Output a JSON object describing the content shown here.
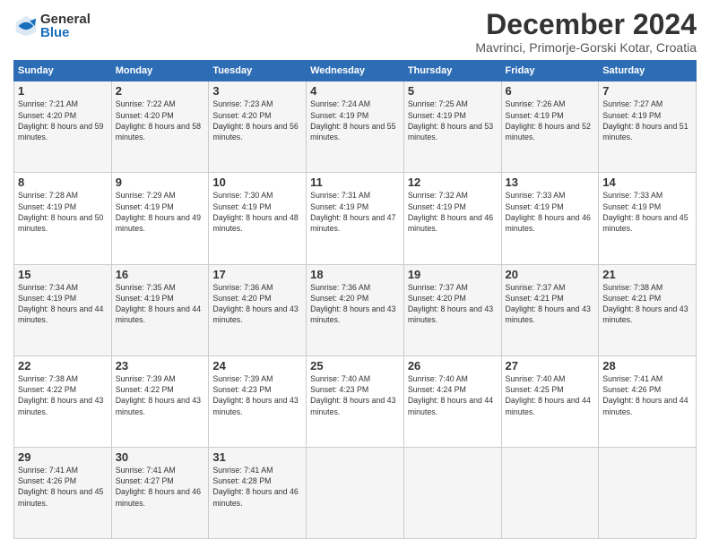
{
  "logo": {
    "general": "General",
    "blue": "Blue"
  },
  "title": {
    "main": "December 2024",
    "sub": "Mavrinci, Primorje-Gorski Kotar, Croatia"
  },
  "headers": [
    "Sunday",
    "Monday",
    "Tuesday",
    "Wednesday",
    "Thursday",
    "Friday",
    "Saturday"
  ],
  "weeks": [
    [
      {
        "day": "1",
        "sunrise": "Sunrise: 7:21 AM",
        "sunset": "Sunset: 4:20 PM",
        "daylight": "Daylight: 8 hours and 59 minutes."
      },
      {
        "day": "2",
        "sunrise": "Sunrise: 7:22 AM",
        "sunset": "Sunset: 4:20 PM",
        "daylight": "Daylight: 8 hours and 58 minutes."
      },
      {
        "day": "3",
        "sunrise": "Sunrise: 7:23 AM",
        "sunset": "Sunset: 4:20 PM",
        "daylight": "Daylight: 8 hours and 56 minutes."
      },
      {
        "day": "4",
        "sunrise": "Sunrise: 7:24 AM",
        "sunset": "Sunset: 4:19 PM",
        "daylight": "Daylight: 8 hours and 55 minutes."
      },
      {
        "day": "5",
        "sunrise": "Sunrise: 7:25 AM",
        "sunset": "Sunset: 4:19 PM",
        "daylight": "Daylight: 8 hours and 53 minutes."
      },
      {
        "day": "6",
        "sunrise": "Sunrise: 7:26 AM",
        "sunset": "Sunset: 4:19 PM",
        "daylight": "Daylight: 8 hours and 52 minutes."
      },
      {
        "day": "7",
        "sunrise": "Sunrise: 7:27 AM",
        "sunset": "Sunset: 4:19 PM",
        "daylight": "Daylight: 8 hours and 51 minutes."
      }
    ],
    [
      {
        "day": "8",
        "sunrise": "Sunrise: 7:28 AM",
        "sunset": "Sunset: 4:19 PM",
        "daylight": "Daylight: 8 hours and 50 minutes."
      },
      {
        "day": "9",
        "sunrise": "Sunrise: 7:29 AM",
        "sunset": "Sunset: 4:19 PM",
        "daylight": "Daylight: 8 hours and 49 minutes."
      },
      {
        "day": "10",
        "sunrise": "Sunrise: 7:30 AM",
        "sunset": "Sunset: 4:19 PM",
        "daylight": "Daylight: 8 hours and 48 minutes."
      },
      {
        "day": "11",
        "sunrise": "Sunrise: 7:31 AM",
        "sunset": "Sunset: 4:19 PM",
        "daylight": "Daylight: 8 hours and 47 minutes."
      },
      {
        "day": "12",
        "sunrise": "Sunrise: 7:32 AM",
        "sunset": "Sunset: 4:19 PM",
        "daylight": "Daylight: 8 hours and 46 minutes."
      },
      {
        "day": "13",
        "sunrise": "Sunrise: 7:33 AM",
        "sunset": "Sunset: 4:19 PM",
        "daylight": "Daylight: 8 hours and 46 minutes."
      },
      {
        "day": "14",
        "sunrise": "Sunrise: 7:33 AM",
        "sunset": "Sunset: 4:19 PM",
        "daylight": "Daylight: 8 hours and 45 minutes."
      }
    ],
    [
      {
        "day": "15",
        "sunrise": "Sunrise: 7:34 AM",
        "sunset": "Sunset: 4:19 PM",
        "daylight": "Daylight: 8 hours and 44 minutes."
      },
      {
        "day": "16",
        "sunrise": "Sunrise: 7:35 AM",
        "sunset": "Sunset: 4:19 PM",
        "daylight": "Daylight: 8 hours and 44 minutes."
      },
      {
        "day": "17",
        "sunrise": "Sunrise: 7:36 AM",
        "sunset": "Sunset: 4:20 PM",
        "daylight": "Daylight: 8 hours and 43 minutes."
      },
      {
        "day": "18",
        "sunrise": "Sunrise: 7:36 AM",
        "sunset": "Sunset: 4:20 PM",
        "daylight": "Daylight: 8 hours and 43 minutes."
      },
      {
        "day": "19",
        "sunrise": "Sunrise: 7:37 AM",
        "sunset": "Sunset: 4:20 PM",
        "daylight": "Daylight: 8 hours and 43 minutes."
      },
      {
        "day": "20",
        "sunrise": "Sunrise: 7:37 AM",
        "sunset": "Sunset: 4:21 PM",
        "daylight": "Daylight: 8 hours and 43 minutes."
      },
      {
        "day": "21",
        "sunrise": "Sunrise: 7:38 AM",
        "sunset": "Sunset: 4:21 PM",
        "daylight": "Daylight: 8 hours and 43 minutes."
      }
    ],
    [
      {
        "day": "22",
        "sunrise": "Sunrise: 7:38 AM",
        "sunset": "Sunset: 4:22 PM",
        "daylight": "Daylight: 8 hours and 43 minutes."
      },
      {
        "day": "23",
        "sunrise": "Sunrise: 7:39 AM",
        "sunset": "Sunset: 4:22 PM",
        "daylight": "Daylight: 8 hours and 43 minutes."
      },
      {
        "day": "24",
        "sunrise": "Sunrise: 7:39 AM",
        "sunset": "Sunset: 4:23 PM",
        "daylight": "Daylight: 8 hours and 43 minutes."
      },
      {
        "day": "25",
        "sunrise": "Sunrise: 7:40 AM",
        "sunset": "Sunset: 4:23 PM",
        "daylight": "Daylight: 8 hours and 43 minutes."
      },
      {
        "day": "26",
        "sunrise": "Sunrise: 7:40 AM",
        "sunset": "Sunset: 4:24 PM",
        "daylight": "Daylight: 8 hours and 44 minutes."
      },
      {
        "day": "27",
        "sunrise": "Sunrise: 7:40 AM",
        "sunset": "Sunset: 4:25 PM",
        "daylight": "Daylight: 8 hours and 44 minutes."
      },
      {
        "day": "28",
        "sunrise": "Sunrise: 7:41 AM",
        "sunset": "Sunset: 4:26 PM",
        "daylight": "Daylight: 8 hours and 44 minutes."
      }
    ],
    [
      {
        "day": "29",
        "sunrise": "Sunrise: 7:41 AM",
        "sunset": "Sunset: 4:26 PM",
        "daylight": "Daylight: 8 hours and 45 minutes."
      },
      {
        "day": "30",
        "sunrise": "Sunrise: 7:41 AM",
        "sunset": "Sunset: 4:27 PM",
        "daylight": "Daylight: 8 hours and 46 minutes."
      },
      {
        "day": "31",
        "sunrise": "Sunrise: 7:41 AM",
        "sunset": "Sunset: 4:28 PM",
        "daylight": "Daylight: 8 hours and 46 minutes."
      },
      null,
      null,
      null,
      null
    ]
  ]
}
